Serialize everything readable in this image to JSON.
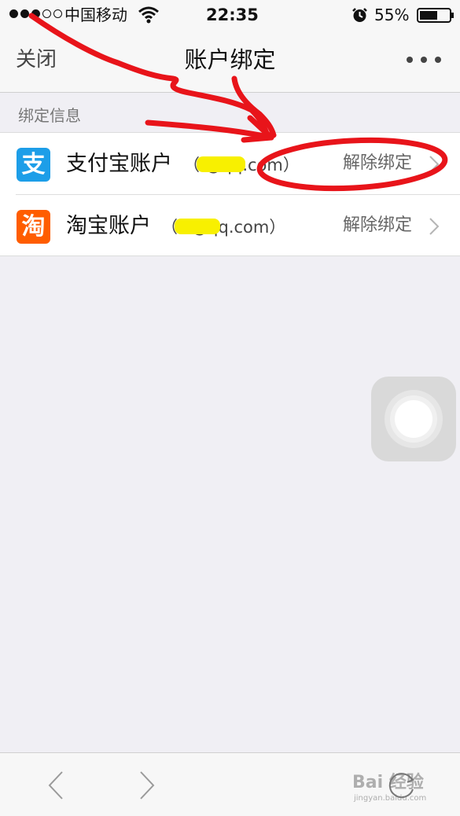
{
  "status_bar": {
    "carrier": "中国移动",
    "time": "22:35",
    "battery": "55%"
  },
  "nav": {
    "close_label": "关闭",
    "title": "账户绑定",
    "more_icon": "more-icon"
  },
  "section": {
    "header": "绑定信息"
  },
  "accounts": [
    {
      "icon_glyph": "支",
      "name": "支付宝账户",
      "email": "（        @qq.com）",
      "action": "解除绑定"
    },
    {
      "icon_glyph": "淘",
      "name": "淘宝账户",
      "email": "（       *@qq.com）",
      "action": "解除绑定"
    }
  ],
  "toolbar": {
    "watermark": "Bai 经验",
    "watermark_sub": "jingyan.baidu.com"
  },
  "colors": {
    "alipay": "#1d9ee8",
    "taobao": "#ff5d00",
    "annotation": "#e8141a",
    "mask": "#f8f000"
  }
}
